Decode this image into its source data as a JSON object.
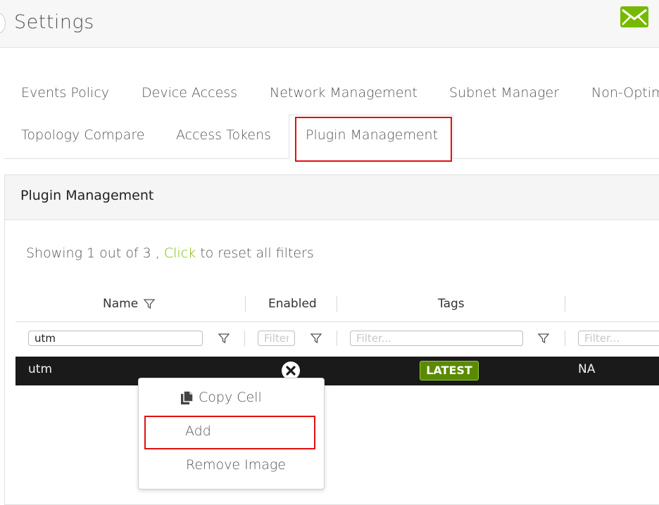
{
  "header": {
    "title": "Settings",
    "mail_icon": "mail-icon",
    "accent_color": "#76b900"
  },
  "tabs": [
    {
      "label": "Events Policy"
    },
    {
      "label": "Device Access"
    },
    {
      "label": "Network Management"
    },
    {
      "label": "Subnet Manager"
    },
    {
      "label": "Non-Optim"
    },
    {
      "label": "Topology Compare"
    },
    {
      "label": "Access Tokens"
    },
    {
      "label": "Plugin Management",
      "active": true
    }
  ],
  "panel": {
    "title": "Plugin Management",
    "showing_prefix": "Showing 1 out of 3 , ",
    "reset_link": "Click",
    "showing_suffix": " to reset all filters"
  },
  "grid": {
    "columns": [
      {
        "label": "Name",
        "filter_value": "utm",
        "filter_placeholder": "Filter..."
      },
      {
        "label": "Enabled",
        "filter_value": "",
        "filter_placeholder": "Filter..."
      },
      {
        "label": "Tags",
        "filter_value": "",
        "filter_placeholder": "Filter..."
      },
      {
        "label": "",
        "filter_value": "",
        "filter_placeholder": "Filter..."
      }
    ],
    "rows": [
      {
        "name": "utm",
        "enabled_icon": "x-circle-icon",
        "tag": "LATEST",
        "extra": "NA"
      }
    ],
    "tag_color": "#5a8a00"
  },
  "context_menu": {
    "items": [
      {
        "label": "Copy Cell",
        "icon": "copy-icon"
      },
      {
        "label": "Add"
      },
      {
        "label": "Remove Image"
      }
    ]
  },
  "highlight_color": "#e01010"
}
